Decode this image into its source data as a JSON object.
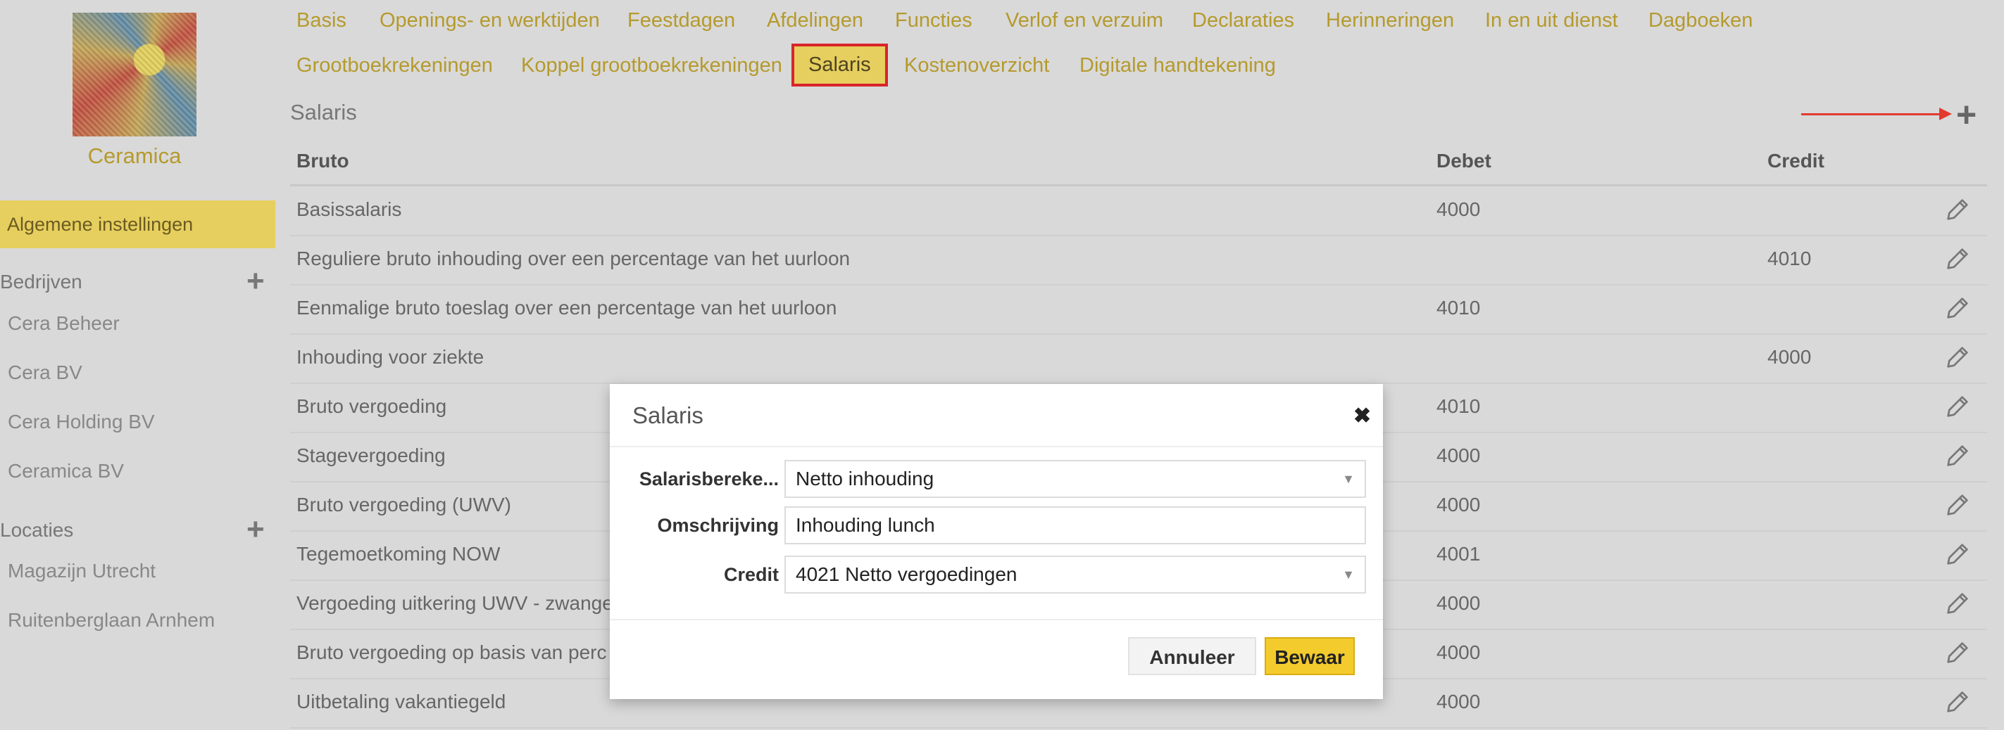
{
  "sidebar": {
    "company_name": "Ceramica",
    "general_settings": "Algemene instellingen",
    "companies_label": "Bedrijven",
    "companies": [
      "Cera Beheer",
      "Cera BV",
      "Cera Holding BV",
      "Ceramica BV"
    ],
    "locations_label": "Locaties",
    "locations": [
      "Magazijn Utrecht",
      "Ruitenberglaan Arnhem"
    ],
    "plus_icon": "+"
  },
  "tabs": {
    "row1": [
      "Basis",
      "Openings- en werktijden",
      "Feestdagen",
      "Afdelingen",
      "Functies",
      "Verlof en verzuim",
      "Declaraties",
      "Herinneringen",
      "In en uit dienst",
      "Dagboeken"
    ],
    "row2": [
      "Grootboekrekeningen",
      "Koppel grootboekrekeningen",
      "Salaris",
      "Kostenoverzicht",
      "Digitale handtekening"
    ],
    "active": "Salaris"
  },
  "page": {
    "title": "Salaris",
    "add_icon": "+"
  },
  "table": {
    "headers": {
      "name": "Bruto",
      "debet": "Debet",
      "credit": "Credit"
    },
    "rows": [
      {
        "name": "Basissalaris",
        "debet": "4000",
        "credit": ""
      },
      {
        "name": "Reguliere bruto inhouding over een percentage van het uurloon",
        "debet": "",
        "credit": "4010"
      },
      {
        "name": "Eenmalige bruto toeslag over een percentage van het uurloon",
        "debet": "4010",
        "credit": ""
      },
      {
        "name": "Inhouding voor ziekte",
        "debet": "",
        "credit": "4000"
      },
      {
        "name": "Bruto vergoeding",
        "debet": "4010",
        "credit": ""
      },
      {
        "name": "Stagevergoeding",
        "debet": "4000",
        "credit": ""
      },
      {
        "name": "Bruto vergoeding (UWV)",
        "debet": "4000",
        "credit": ""
      },
      {
        "name": "Tegemoetkoming NOW",
        "debet": "4001",
        "credit": ""
      },
      {
        "name": "Vergoeding uitkering UWV - zwange",
        "debet": "4000",
        "credit": ""
      },
      {
        "name": "Bruto vergoeding op basis van perc",
        "debet": "4000",
        "credit": ""
      },
      {
        "name": "Uitbetaling vakantiegeld",
        "debet": "4000",
        "credit": ""
      }
    ]
  },
  "modal": {
    "title": "Salaris",
    "close_icon": "✖",
    "fields": {
      "salary_calc_label": "Salarisbereke...",
      "salary_calc_value": "Netto inhouding",
      "description_label": "Omschrijving",
      "description_value": "Inhouding lunch",
      "credit_label": "Credit",
      "credit_value": "4021 Netto vergoedingen"
    },
    "cancel_label": "Annuleer",
    "save_label": "Bewaar",
    "caret": "▼"
  },
  "colors": {
    "accent": "#b59a2d",
    "active_bg": "#e6cf5e",
    "highlight_border": "#d8252b",
    "arrow": "#e23b2e",
    "save_btn": "#f4cb2c"
  }
}
